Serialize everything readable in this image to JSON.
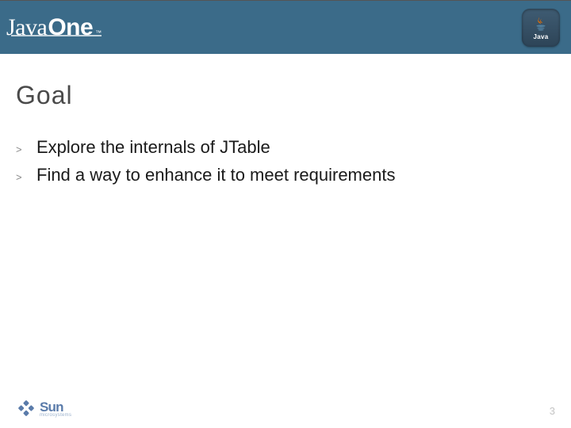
{
  "header": {
    "brand_left_a": "Java",
    "brand_left_b": "One",
    "trademark": "™",
    "brand_right_label": "Java"
  },
  "slide": {
    "title": "Goal",
    "bullets": [
      "Explore the internals of JTable",
      "Find a way to enhance it to meet requirements"
    ],
    "bullet_marker": ">"
  },
  "footer": {
    "sun_text": "Sun",
    "sun_sub": "microsystems",
    "page_number": "3"
  }
}
